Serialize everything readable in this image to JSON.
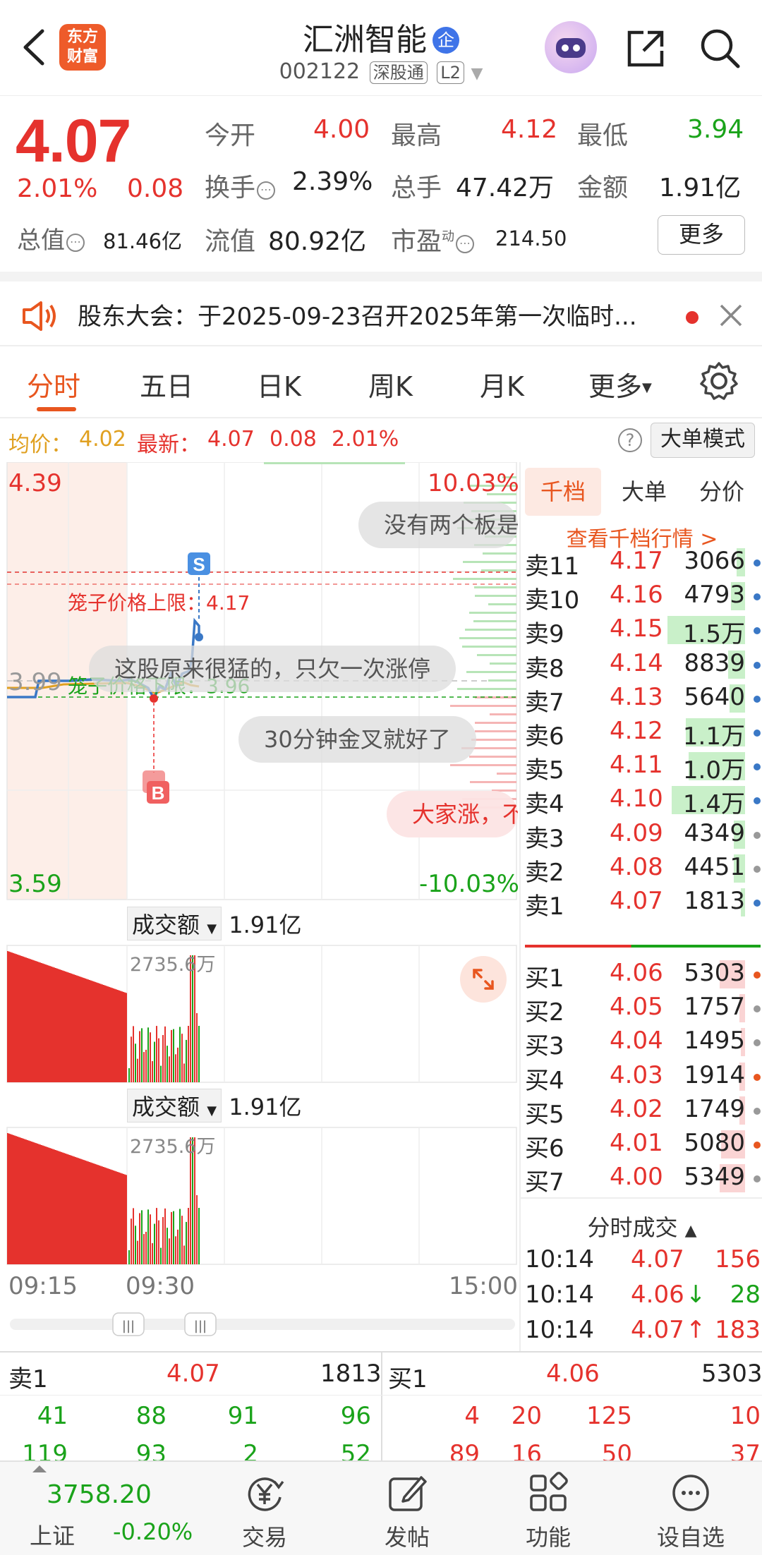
{
  "header": {
    "logo_line1": "东方",
    "logo_line2": "财富",
    "stock_name": "汇洲智能",
    "qi_badge": "企",
    "stock_code": "002122",
    "connect_tag": "深股通",
    "level_tag": "L2"
  },
  "quote": {
    "price": "4.07",
    "change_pct": "2.01%",
    "change_amt": "0.08",
    "open_label": "今开",
    "open_value": "4.00",
    "high_label": "最高",
    "high_value": "4.12",
    "low_label": "最低",
    "low_value": "3.94",
    "turnover_label": "换手",
    "turnover_value": "2.39%",
    "volume_label": "总手",
    "volume_value": "47.42万",
    "amount_label": "金额",
    "amount_value": "1.91亿",
    "mktcap_label": "总值",
    "mktcap_value": "81.46亿",
    "float_label": "流值",
    "float_value": "80.92亿",
    "pe_label": "市盈",
    "pe_sup": "动",
    "pe_value": "214.50",
    "more_button": "更多"
  },
  "notice": {
    "text": "股东大会：于2025-09-23召开2025年第一次临时..."
  },
  "tabs": [
    "分时",
    "五日",
    "日K",
    "周K",
    "月K",
    "更多"
  ],
  "info_bar": {
    "avg_label": "均价：",
    "avg_value": "4.02",
    "latest_label": "最新：",
    "latest_value": "4.07",
    "latest_change": "0.08",
    "latest_pct": "2.01%",
    "big_order_button": "大单模式"
  },
  "chart": {
    "y_top": "4.39",
    "y_mid": "3.99",
    "y_bottom": "3.59",
    "pct_top": "10.03%",
    "pct_bottom": "-10.03%",
    "upper_limit_label": "笼子价格上限：4.17",
    "lower_limit_label": "笼子价格下限：3.96",
    "sell_marker": "S",
    "buy_marker": "B",
    "danmu": [
      "没有两个板是",
      "这股原来很猛的，只欠一次涨停",
      "30分钟金叉就好了",
      "大家涨，不"
    ],
    "volume_panels": [
      {
        "label": "成交额",
        "total": "1.91亿",
        "peak": "2735.6万"
      },
      {
        "label": "成交额",
        "total": "1.91亿",
        "peak": "2735.6万"
      }
    ],
    "time_axis": [
      "09:15",
      "09:30",
      "15:00"
    ],
    "colors": {
      "up": "#e5322d",
      "down": "#1aa31a",
      "price_line": "#3a78c6",
      "avg_line": "#e0a020"
    }
  },
  "order_book": {
    "tabs": [
      "千档",
      "大单",
      "分价"
    ],
    "view_link": "查看千档行情 >",
    "asks": [
      {
        "label": "卖11",
        "price": "4.17",
        "vol": "3066",
        "bar": 0.06,
        "dot": "blue"
      },
      {
        "label": "卖10",
        "price": "4.16",
        "vol": "4793",
        "bar": 0.1,
        "dot": "blue"
      },
      {
        "label": "卖9",
        "price": "4.15",
        "vol": "1.5万",
        "bar": 0.55,
        "dot": "blue"
      },
      {
        "label": "卖8",
        "price": "4.14",
        "vol": "8839",
        "bar": 0.12,
        "dot": "blue"
      },
      {
        "label": "卖7",
        "price": "4.13",
        "vol": "5640",
        "bar": 0.11,
        "dot": "blue"
      },
      {
        "label": "卖6",
        "price": "4.12",
        "vol": "1.1万",
        "bar": 0.42,
        "dot": "blue"
      },
      {
        "label": "卖5",
        "price": "4.11",
        "vol": "1.0万",
        "bar": 0.4,
        "dot": "blue"
      },
      {
        "label": "卖4",
        "price": "4.10",
        "vol": "1.4万",
        "bar": 0.52,
        "dot": "blue"
      },
      {
        "label": "卖3",
        "price": "4.09",
        "vol": "4349",
        "bar": 0.08,
        "dot": "gray"
      },
      {
        "label": "卖2",
        "price": "4.08",
        "vol": "4451",
        "bar": 0.08,
        "dot": "gray"
      },
      {
        "label": "卖1",
        "price": "4.07",
        "vol": "1813",
        "bar": 0.03,
        "dot": "blue"
      }
    ],
    "bids": [
      {
        "label": "买1",
        "price": "4.06",
        "vol": "5303",
        "bar": 0.18,
        "dot": "orange"
      },
      {
        "label": "买2",
        "price": "4.05",
        "vol": "1757",
        "bar": 0.04,
        "dot": "gray"
      },
      {
        "label": "买3",
        "price": "4.04",
        "vol": "1495",
        "bar": 0.03,
        "dot": "gray"
      },
      {
        "label": "买4",
        "price": "4.03",
        "vol": "1914",
        "bar": 0.04,
        "dot": "orange"
      },
      {
        "label": "买5",
        "price": "4.02",
        "vol": "1749",
        "bar": 0.04,
        "dot": "gray"
      },
      {
        "label": "买6",
        "price": "4.01",
        "vol": "5080",
        "bar": 0.17,
        "dot": "orange"
      },
      {
        "label": "买7",
        "price": "4.00",
        "vol": "5349",
        "bar": 0.18,
        "dot": "gray"
      }
    ],
    "trades_title": "分时成交",
    "trades": [
      {
        "time": "10:14",
        "price": "4.07",
        "arrow": "",
        "vol": "156",
        "color": "red"
      },
      {
        "time": "10:14",
        "price": "4.06",
        "arrow": "↓",
        "vol": "28",
        "color": "green"
      },
      {
        "time": "10:14",
        "price": "4.07",
        "arrow": "↑",
        "vol": "183",
        "color": "red"
      }
    ]
  },
  "level2": {
    "sell_label": "卖1",
    "sell_price": "4.07",
    "sell_vol": "1813",
    "buy_label": "买1",
    "buy_price": "4.06",
    "buy_vol": "5303",
    "sell_row1": [
      "41",
      "88",
      "91",
      "96"
    ],
    "sell_row2": [
      "119",
      "93",
      "2",
      "52"
    ],
    "buy_row1": [
      "4",
      "20",
      "125",
      "10"
    ],
    "buy_row2": [
      "89",
      "16",
      "50",
      "37"
    ]
  },
  "bottom_nav": {
    "index_value": "3758.20",
    "index_name": "上证",
    "index_change": "-0.20%",
    "items": [
      "交易",
      "发帖",
      "功能",
      "设自选"
    ]
  }
}
